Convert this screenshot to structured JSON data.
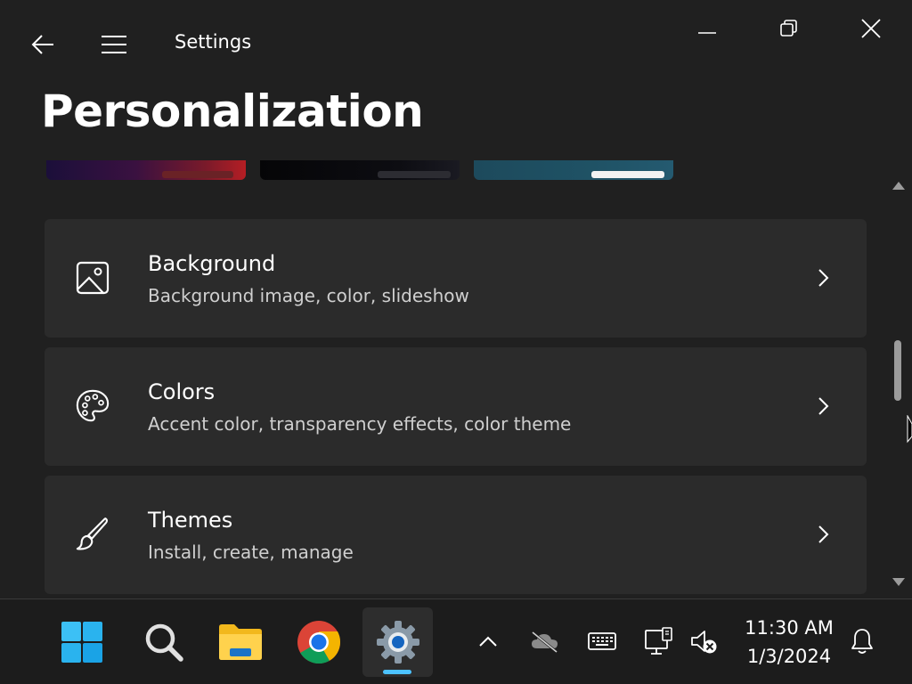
{
  "window": {
    "app_title": "Settings",
    "page_title": "Personalization"
  },
  "cards": [
    {
      "title": "Background",
      "subtitle": "Background image, color, slideshow",
      "icon": "image-icon"
    },
    {
      "title": "Colors",
      "subtitle": "Accent color, transparency effects, color theme",
      "icon": "palette-icon"
    },
    {
      "title": "Themes",
      "subtitle": "Install, create, manage",
      "icon": "brush-icon"
    }
  ],
  "taskbar": {
    "apps": [
      "windows-start-icon",
      "search-icon",
      "file-explorer-icon",
      "chrome-icon",
      "settings-gear-icon"
    ],
    "active_app": "Settings",
    "time": "11:30 AM",
    "date": "1/3/2024"
  },
  "colors": {
    "background": "#202020",
    "card": "#2b2b2b",
    "taskbar": "#1c1c1c",
    "accent": "#4cc2ff"
  }
}
